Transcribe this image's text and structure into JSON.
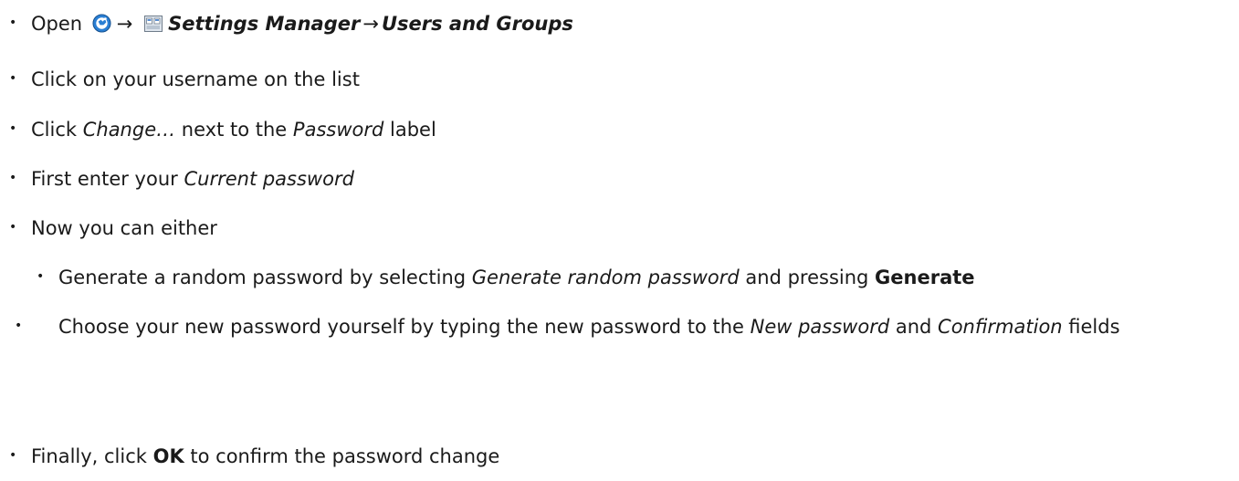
{
  "steps": {
    "open": {
      "prefix": "Open",
      "arrow1": "→",
      "app_label": "Settings Manager",
      "arrow2": "→",
      "section_label": "Users and Groups"
    },
    "click_username": "Click on your username on the list",
    "click_change": {
      "prefix": "Click ",
      "button": "Change…",
      "middle": " next to the ",
      "field": "Password",
      "suffix": " label"
    },
    "current_password": {
      "prefix": "First enter your ",
      "field": "Current password"
    },
    "either": "Now you can either",
    "generate": {
      "prefix": "Generate a random password by selecting ",
      "option": "Generate random password",
      "middle": " and pressing ",
      "button": "Generate"
    },
    "choose": {
      "prefix": "Choose your new password yourself by typing the new password to the ",
      "field1": "New password",
      "middle": " and ",
      "field2": "Confirmation",
      "suffix": " fields"
    },
    "finally": {
      "prefix": "Finally, click ",
      "button": "OK",
      "suffix": " to confirm the password change"
    }
  },
  "icons": {
    "menu": "xfce-menu-icon",
    "settings": "settings-manager-icon"
  },
  "colors": {
    "menu_icon_fill": "#2a7fd4",
    "settings_icon_fill": "#dfe6ee",
    "text": "#1a1a1a"
  }
}
